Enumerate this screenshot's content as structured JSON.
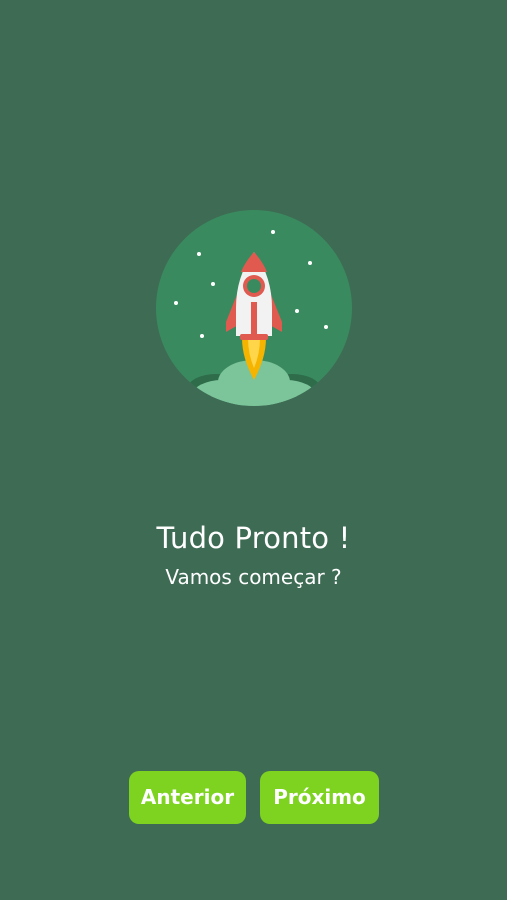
{
  "colors": {
    "background": "#3e6b54",
    "circle": "#3a8a5f",
    "button": "#7ed321",
    "rocket_body": "#f2f2f2",
    "rocket_accent": "#e05a50",
    "flame": "#f5b400",
    "cloud": "#7cc49a",
    "cloud_dark": "#2e6c4a"
  },
  "illustration": {
    "icon": "rocket-launch-icon"
  },
  "message": {
    "title": "Tudo Pronto !",
    "subtitle": "Vamos começar ?"
  },
  "navigation": {
    "previous_label": "Anterior",
    "next_label": "Próximo"
  }
}
